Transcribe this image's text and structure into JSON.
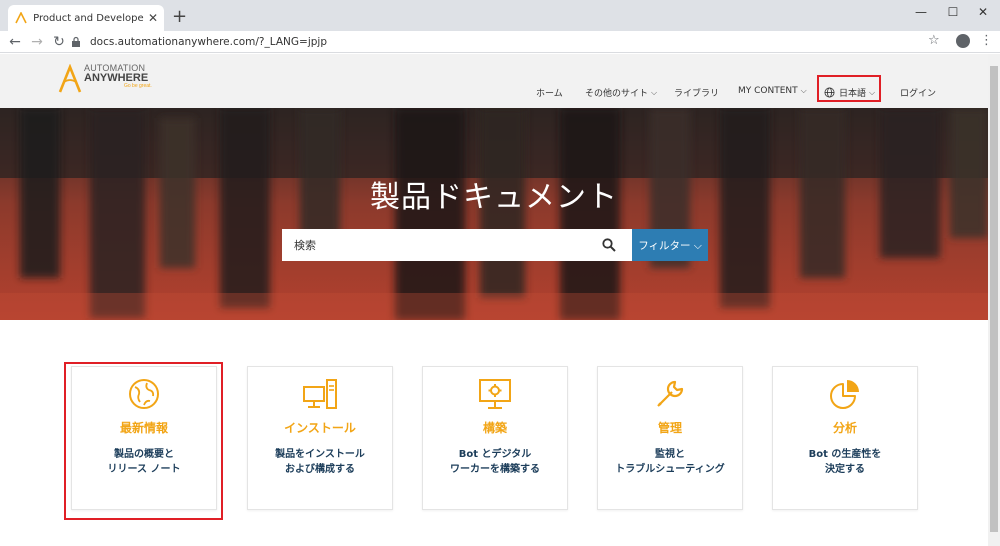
{
  "browser": {
    "tab_title": "Product and Developer Documen",
    "tab_close": "✕",
    "new_tab": "+",
    "url": "docs.automationanywhere.com/?_LANG=jpjp",
    "window_controls": {
      "minimize": "—",
      "maximize": "☐",
      "close": "✕"
    },
    "nav": {
      "back": "←",
      "forward": "→",
      "reload": "↻"
    },
    "star": "☆",
    "menu": "⋮"
  },
  "logo": {
    "line1": "AUTOMATION",
    "line2": "ANYWHERE",
    "tagline": "Go be great.",
    "accent_color": "#f2a516"
  },
  "nav": {
    "home": "ホーム",
    "other_sites": "その他のサイト",
    "library": "ライブラリ",
    "my_content": "MY CONTENT",
    "language": "日本語",
    "login": "ログイン",
    "chevron": "⌵"
  },
  "hero": {
    "title": "製品ドキュメント",
    "search_placeholder": "検索",
    "filter_label": "フィルター ⌵",
    "filter_color": "#2d7db3"
  },
  "cards": [
    {
      "icon": "globe-icon",
      "title": "最新情報",
      "desc": "製品の概要と\nリリース ノート"
    },
    {
      "icon": "computer-server-icon",
      "title": "インストール",
      "desc": "製品をインストール\nおよび構成する"
    },
    {
      "icon": "monitor-gear-icon",
      "title": "構築",
      "desc": "Bot とデジタル\nワーカーを構築する"
    },
    {
      "icon": "wrench-icon",
      "title": "管理",
      "desc": "監視と\nトラブルシューティング"
    },
    {
      "icon": "pie-chart-icon",
      "title": "分析",
      "desc": "Bot の生産性を\n決定する"
    }
  ],
  "highlight_color": "#e01f26"
}
